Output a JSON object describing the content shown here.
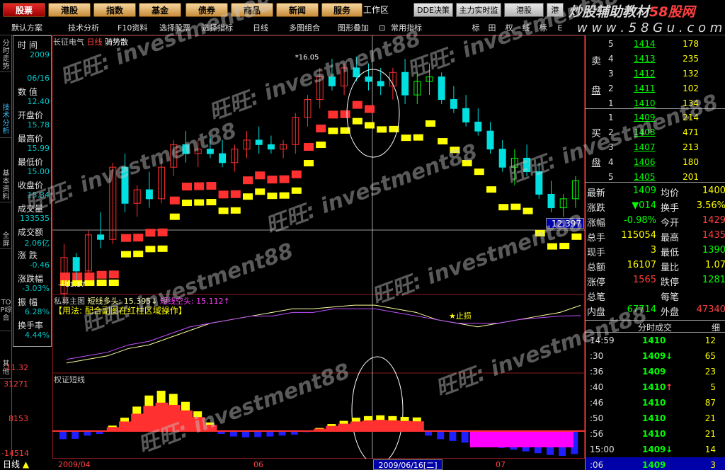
{
  "top_nav": {
    "buttons": [
      "股票",
      "港股",
      "指数",
      "基金",
      "债券",
      "商品",
      "新闻",
      "服务"
    ],
    "active_index": 0,
    "workspace": "工作区",
    "tools": [
      "DDE决策",
      "主力实时监",
      "港股",
      "港"
    ],
    "brand_a": "炒股辅助教材",
    "brand_b": "58股网",
    "url": "w w w . 5 8 G u . c o m"
  },
  "toolbar": {
    "items": [
      "默认方案",
      "技术分析",
      "F10资料",
      "选择股票",
      "选择指标",
      "日线",
      "多图组合",
      "图形叠加",
      "常用指标"
    ],
    "icons": [
      "标",
      "田",
      "权",
      "线",
      "标",
      "E"
    ]
  },
  "vtabs": [
    {
      "label": "分时走势",
      "active": false
    },
    {
      "label": "技术分析",
      "active": true
    },
    {
      "label": "基本资料",
      "active": false
    },
    {
      "label": "全屏",
      "active": false
    },
    {
      "label": "TOP综合",
      "active": false
    },
    {
      "label": "其他",
      "active": false
    }
  ],
  "info_panel": {
    "rows": [
      {
        "k": "时 间",
        "v": "2009"
      },
      {
        "k": "",
        "v": "06/16"
      },
      {
        "k": "数 值",
        "v": "12.40"
      },
      {
        "k": "开盘价",
        "v": "15.78"
      },
      {
        "k": "最高价",
        "v": "15.99"
      },
      {
        "k": "最低价",
        "v": "15.00"
      },
      {
        "k": "收盘价",
        "v": "15.34"
      },
      {
        "k": "成交量",
        "v": "133535"
      },
      {
        "k": "成交额",
        "v": "2.06亿"
      },
      {
        "k": "涨 跌",
        "v": "-0.46"
      },
      {
        "k": "涨跌幅",
        "v": "-3.03%"
      },
      {
        "k": "振 幅",
        "v": "6.28%"
      },
      {
        "k": "换手率",
        "v": "4.44%"
      }
    ]
  },
  "chart": {
    "stock_name": "长征电气",
    "period": "日线",
    "indicator": "骑势散",
    "high_label": "16.05",
    "low_label": "11.17",
    "current_price_tag": "12.397",
    "ind1_title": "私募主图",
    "ind1_line1": "短线多头: 15.395↓",
    "ind1_line2": "短线空头: 15.112↑",
    "ind1_note": "【用法: 配合副图在红柱区域操作】",
    "ind1_ylab": "11.32",
    "ind1_star": "止损",
    "ind2_title": "权证短线",
    "ind2_ylab_top": "31271",
    "ind2_ylab_mid": "8153",
    "ind2_ylab_bot": "-14514",
    "x_labels": [
      "2009/04",
      "06",
      "07"
    ],
    "cursor_date": "2009/06/16[二]",
    "colors": {
      "up": "#ff3030",
      "down": "#00e0e0",
      "yellow": "#ffff00",
      "magenta": "#ff00ff",
      "blue": "#1f1fff"
    }
  },
  "chart_data": [
    {
      "type": "candlestick",
      "title": "长征电气 日线",
      "candles": [
        [
          10.8,
          11.9,
          10.6,
          11.6
        ],
        [
          11.6,
          11.7,
          11.1,
          11.3
        ],
        [
          11.3,
          12.2,
          11.2,
          12.1
        ],
        [
          12.1,
          12.6,
          11.8,
          12.0
        ],
        [
          12.0,
          13.7,
          11.9,
          13.6
        ],
        [
          13.6,
          13.9,
          12.6,
          12.8
        ],
        [
          12.8,
          13.2,
          12.5,
          13.1
        ],
        [
          13.1,
          13.5,
          12.7,
          12.9
        ],
        [
          12.9,
          13.8,
          12.8,
          13.6
        ],
        [
          13.6,
          14.2,
          13.4,
          14.1
        ],
        [
          14.1,
          14.4,
          13.7,
          13.9
        ],
        [
          13.9,
          14.2,
          13.6,
          14.0
        ],
        [
          14.0,
          14.3,
          13.8,
          13.9
        ],
        [
          13.9,
          14.2,
          13.6,
          13.7
        ],
        [
          13.7,
          14.1,
          13.5,
          14.0
        ],
        [
          14.0,
          14.4,
          13.8,
          14.2
        ],
        [
          14.2,
          14.5,
          13.9,
          14.1
        ],
        [
          14.1,
          14.3,
          13.9,
          14.0
        ],
        [
          14.0,
          14.2,
          13.8,
          14.1
        ],
        [
          14.1,
          14.8,
          13.9,
          14.7
        ],
        [
          14.7,
          15.2,
          14.5,
          15.1
        ],
        [
          15.1,
          15.8,
          14.9,
          15.6
        ],
        [
          15.6,
          16.0,
          15.3,
          15.4
        ],
        [
          15.4,
          15.9,
          15.2,
          15.8
        ],
        [
          15.8,
          16.05,
          15.5,
          15.6
        ],
        [
          15.6,
          15.9,
          15.3,
          15.5
        ],
        [
          15.5,
          15.8,
          15.2,
          15.4
        ],
        [
          15.4,
          15.8,
          15.1,
          15.7
        ],
        [
          15.7,
          16.0,
          15.0,
          15.2
        ],
        [
          15.2,
          15.7,
          15.0,
          15.5
        ],
        [
          15.5,
          15.9,
          15.2,
          15.6
        ],
        [
          15.6,
          15.7,
          15.0,
          15.1
        ],
        [
          15.1,
          15.4,
          14.8,
          14.9
        ],
        [
          14.9,
          15.2,
          14.5,
          14.6
        ],
        [
          14.6,
          14.9,
          14.3,
          14.4
        ],
        [
          14.4,
          14.6,
          13.9,
          14.0
        ],
        [
          14.0,
          14.2,
          13.5,
          13.6
        ],
        [
          13.6,
          14.0,
          13.2,
          13.8
        ],
        [
          13.8,
          14.1,
          13.4,
          13.5
        ],
        [
          13.5,
          13.7,
          12.9,
          13.0
        ],
        [
          13.0,
          13.3,
          12.6,
          12.7
        ],
        [
          12.7,
          13.0,
          12.5,
          12.9
        ],
        [
          12.9,
          13.4,
          12.7,
          13.3
        ]
      ],
      "ylim": [
        11.0,
        16.3
      ]
    },
    {
      "type": "line",
      "title": "私募主图",
      "series": [
        {
          "name": "短线多头",
          "values": [
            13.8,
            13.9,
            14.0,
            14.2,
            14.3,
            14.5,
            14.7,
            14.9,
            15.0,
            15.1,
            15.2,
            15.3,
            15.3,
            15.35,
            15.4,
            15.4,
            15.3,
            15.2,
            15.0,
            14.9,
            14.8,
            14.9,
            15.0,
            15.1,
            15.2,
            15.395
          ]
        },
        {
          "name": "短线空头",
          "values": [
            13.9,
            14.0,
            14.1,
            14.3,
            14.4,
            14.6,
            14.8,
            14.9,
            15.0,
            15.1,
            15.1,
            15.2,
            15.2,
            15.3,
            15.3,
            15.3,
            15.2,
            15.1,
            15.0,
            14.9,
            14.9,
            14.9,
            15.0,
            15.05,
            15.1,
            15.112
          ]
        }
      ]
    },
    {
      "type": "bar",
      "title": "权证短线",
      "values": [
        -5000,
        -4800,
        -3000,
        -2000,
        3000,
        8000,
        15000,
        22000,
        25000,
        23000,
        18000,
        12000,
        5000,
        -2000,
        -3500,
        -4000,
        -3800,
        -3500,
        -3000,
        -2500,
        -1000,
        1500,
        4000,
        6000,
        8000,
        9000,
        9500,
        9000,
        8500,
        8153,
        -3000,
        -5000,
        -6000,
        -7000,
        -8000,
        -9000,
        -10000,
        -11000,
        -12000,
        -13000,
        -14000,
        -14514,
        -13500
      ],
      "ylim": [
        -14514,
        31271
      ]
    }
  ],
  "order_book": {
    "sell_label": [
      "卖",
      "盘"
    ],
    "buy_label": [
      "买",
      "盘"
    ],
    "sells": [
      {
        "i": "5",
        "p": "1414",
        "v": "178"
      },
      {
        "i": "4",
        "p": "1413",
        "v": "235"
      },
      {
        "i": "3",
        "p": "1412",
        "v": "132"
      },
      {
        "i": "2",
        "p": "1411",
        "v": "102"
      },
      {
        "i": "1",
        "p": "1410",
        "v": "134"
      }
    ],
    "buys": [
      {
        "i": "1",
        "p": "1409",
        "v": "214"
      },
      {
        "i": "2",
        "p": "1408",
        "v": "471"
      },
      {
        "i": "3",
        "p": "1407",
        "v": "213"
      },
      {
        "i": "4",
        "p": "1406",
        "v": "180"
      },
      {
        "i": "5",
        "p": "1405",
        "v": "201"
      }
    ]
  },
  "stats": {
    "rows": [
      {
        "k1": "最新",
        "v1": "1409",
        "c1": "g",
        "k2": "均价",
        "v2": "1400",
        "c2": "y"
      },
      {
        "k1": "涨跌",
        "v1": "▼014",
        "c1": "g",
        "k2": "换手",
        "v2": "3.56%",
        "c2": "y"
      },
      {
        "k1": "涨幅",
        "v1": "-0.98%",
        "c1": "g",
        "k2": "今开",
        "v2": "1429",
        "c2": "r"
      },
      {
        "k1": "总手",
        "v1": "115054",
        "c1": "y",
        "k2": "最高",
        "v2": "1435",
        "c2": "r"
      },
      {
        "k1": "现手",
        "v1": "3",
        "c1": "y",
        "k2": "最低",
        "v2": "1390",
        "c2": "g"
      },
      {
        "k1": "总额",
        "v1": "16107",
        "c1": "y",
        "k2": "量比",
        "v2": "1.07",
        "c2": "y"
      },
      {
        "k1": "涨停",
        "v1": "1565",
        "c1": "r",
        "k2": "跌停",
        "v2": "1281",
        "c2": "g"
      },
      {
        "k1": "总笔",
        "v1": "",
        "c1": "w",
        "k2": "每笔",
        "v2": "",
        "c2": "w"
      },
      {
        "k1": "内盘",
        "v1": "67714",
        "c1": "g",
        "k2": "外盘",
        "v2": "47340",
        "c2": "r"
      }
    ]
  },
  "ticks": {
    "title": "分时成交",
    "detail": "细",
    "rows": [
      {
        "t": "14:59",
        "p": "1410",
        "a": "",
        "v": "12"
      },
      {
        "t": ":30",
        "p": "1409",
        "a": "↓",
        "v": "65"
      },
      {
        "t": ":36",
        "p": "1409",
        "a": "",
        "v": "23"
      },
      {
        "t": ":40",
        "p": "1410",
        "a": "↑",
        "v": "5"
      },
      {
        "t": ":46",
        "p": "1410",
        "a": "",
        "v": "87"
      },
      {
        "t": ":50",
        "p": "1410",
        "a": "",
        "v": "21"
      },
      {
        "t": ":56",
        "p": "1410",
        "a": "",
        "v": "21"
      },
      {
        "t": "15:00",
        "p": "1409",
        "a": "↓",
        "v": "14"
      },
      {
        "t": ":06",
        "p": "1409",
        "a": "",
        "v": "3"
      }
    ],
    "selected_index": 8
  },
  "watermark": [
    "旺旺:",
    "investment88"
  ],
  "bottom_tab": "日线"
}
